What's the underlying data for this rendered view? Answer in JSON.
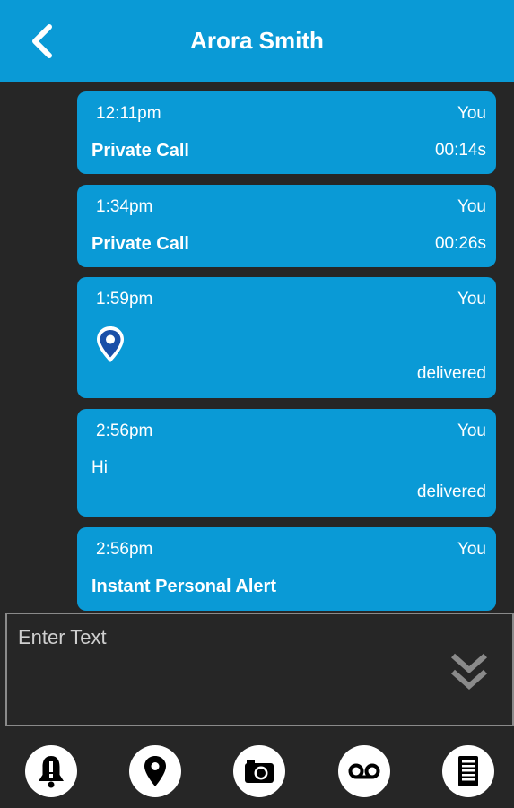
{
  "header": {
    "title": "Arora Smith",
    "back_icon": "chevron-left-icon"
  },
  "colors": {
    "accent": "#0a9ad6",
    "background": "#262626"
  },
  "messages": [
    {
      "time": "12:11pm",
      "sender": "You",
      "kind": "Private Call",
      "duration": "00:14s"
    },
    {
      "time": "1:34pm",
      "sender": "You",
      "kind": "Private Call",
      "duration": "00:26s"
    },
    {
      "time": "1:59pm",
      "sender": "You",
      "icon": "location-pin-icon",
      "status": "delivered"
    },
    {
      "time": "2:56pm",
      "sender": "You",
      "text": "Hi",
      "status": "delivered"
    },
    {
      "time": "2:56pm",
      "sender": "You",
      "kind": "Instant Personal Alert"
    }
  ],
  "composer": {
    "placeholder": "Enter Text",
    "expand_icon": "double-chevron-down-icon"
  },
  "toolbar": {
    "items": [
      {
        "icon": "alert-bell-icon"
      },
      {
        "icon": "location-pin-icon"
      },
      {
        "icon": "camera-icon"
      },
      {
        "icon": "voicemail-icon"
      },
      {
        "icon": "document-icon"
      }
    ]
  }
}
